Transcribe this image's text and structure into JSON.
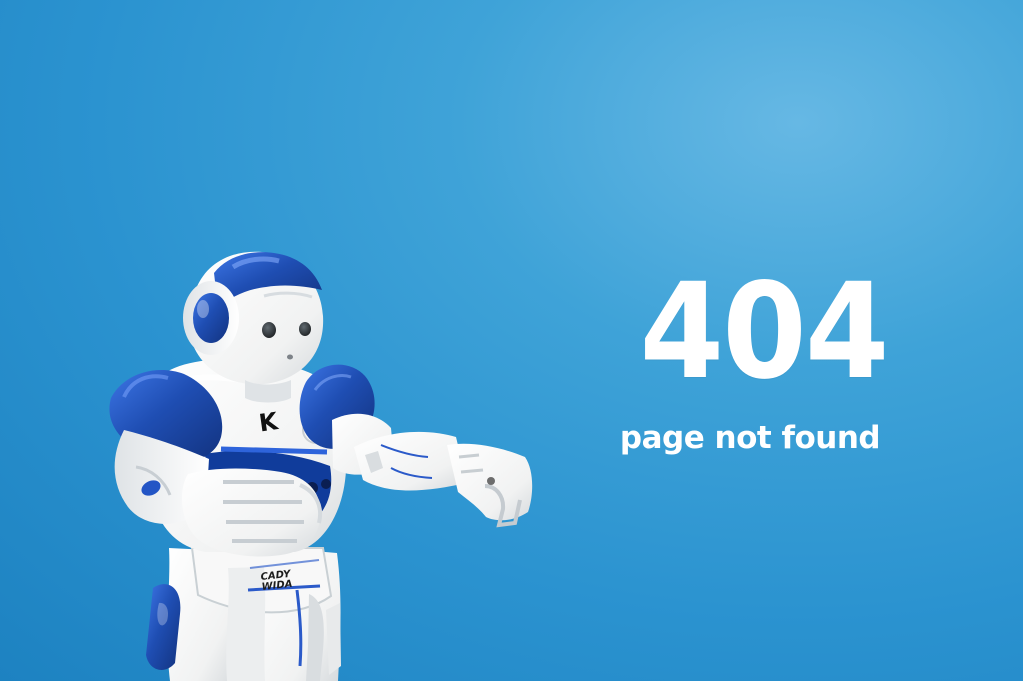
{
  "error": {
    "code": "404",
    "message": "page not found"
  },
  "robot": {
    "chest_logo": "K",
    "belt_label": "CADY WIDA"
  },
  "colors": {
    "background": "#2b93d0",
    "accent": "#1f4eb3",
    "text": "#ffffff",
    "robot_body": "#f7f7f5"
  },
  "icons": {
    "robot": "robot-figure",
    "power": "power-icon"
  }
}
